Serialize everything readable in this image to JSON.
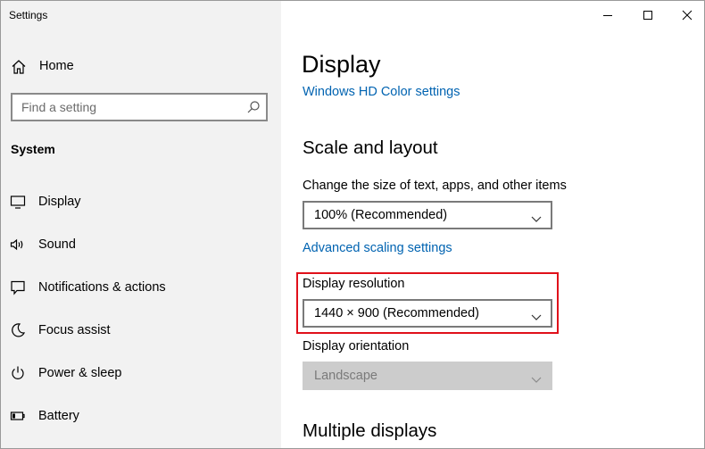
{
  "window": {
    "title": "Settings"
  },
  "sidebar": {
    "home_label": "Home",
    "search_placeholder": "Find a setting",
    "section_title": "System",
    "items": [
      {
        "label": "Display",
        "icon": "monitor-icon"
      },
      {
        "label": "Sound",
        "icon": "speaker-icon"
      },
      {
        "label": "Notifications & actions",
        "icon": "notification-icon"
      },
      {
        "label": "Focus assist",
        "icon": "moon-icon"
      },
      {
        "label": "Power & sleep",
        "icon": "power-icon"
      },
      {
        "label": "Battery",
        "icon": "battery-icon"
      }
    ]
  },
  "main": {
    "title": "Display",
    "hd_color_link": "Windows HD Color settings",
    "scale_section_title": "Scale and layout",
    "scale_label": "Change the size of text, apps, and other items",
    "scale_value": "100% (Recommended)",
    "advanced_scaling_link": "Advanced scaling settings",
    "resolution_label": "Display resolution",
    "resolution_value": "1440 × 900 (Recommended)",
    "orientation_label": "Display orientation",
    "orientation_value": "Landscape",
    "orientation_disabled": true,
    "multiple_displays_title": "Multiple displays"
  },
  "colors": {
    "link": "#0063b1",
    "highlight_border": "#e0101a",
    "sidebar_bg": "#f2f2f2"
  }
}
